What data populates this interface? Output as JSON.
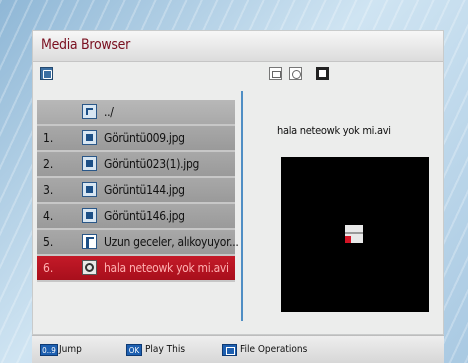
{
  "title": "Media Browser",
  "file_list": [
    {
      "num": "",
      "name": "../",
      "icon": "folder-up-icon"
    },
    {
      "num": "1.",
      "name": "Görüntü009.jpg",
      "icon": "image-file-icon"
    },
    {
      "num": "2.",
      "name": "Görüntü023(1).jpg",
      "icon": "image-file-icon"
    },
    {
      "num": "3.",
      "name": "Görüntü144.jpg",
      "icon": "image-file-icon"
    },
    {
      "num": "4.",
      "name": "Görüntü146.jpg",
      "icon": "image-file-icon"
    },
    {
      "num": "5.",
      "name": "Uzun geceler, alıkoyuyor...",
      "icon": "audio-file-icon"
    },
    {
      "num": "6.",
      "name": "hala neteowk yok mi.avi",
      "icon": "video-file-icon",
      "selected": true
    }
  ],
  "preview": {
    "filename": "hala neteowk yok mi.avi"
  },
  "footer": {
    "jump_key": "0..9",
    "jump_label": "Jump",
    "ok_key": "OK",
    "ok_label": "Play This",
    "file_label": "File Operations"
  },
  "colors": {
    "title": "#7a1020",
    "selected_row": "#b8121f",
    "accent": "#1d5fb0"
  }
}
